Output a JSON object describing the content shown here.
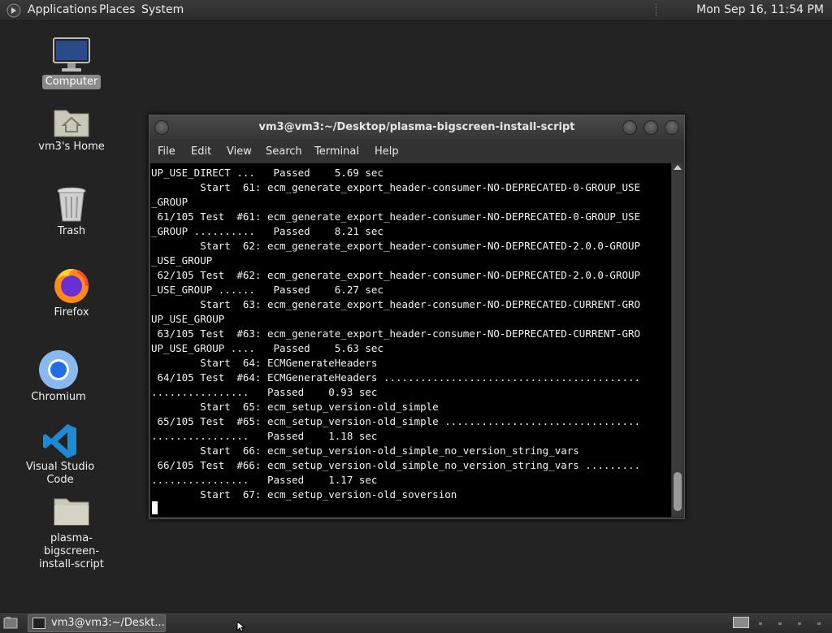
{
  "top_panel": {
    "menus": [
      "Applications",
      "Places",
      "System"
    ],
    "clock": "Mon Sep 16, 11:54 PM",
    "logo_icon": "gnome-foot-icon"
  },
  "desktop_icons": [
    {
      "label": "Computer",
      "icon": "computer-icon",
      "selected": true
    },
    {
      "label": "vm3's Home",
      "icon": "home-folder-icon"
    },
    {
      "label": "Trash",
      "icon": "trash-icon"
    },
    {
      "label": "Firefox",
      "icon": "firefox-icon"
    },
    {
      "label": "Chromium",
      "icon": "chromium-icon"
    },
    {
      "label": "Visual Studio Code",
      "icon": "vscode-icon"
    },
    {
      "label": "plasma-bigscreen-install-script",
      "label_lines": [
        "plasma-bigscreen-",
        "install-script"
      ],
      "icon": "folder-icon"
    }
  ],
  "terminal": {
    "title": "vm3@vm3:~/Desktop/plasma-bigscreen-install-script",
    "menu": [
      "File",
      "Edit",
      "View",
      "Search",
      "Terminal",
      "Help"
    ],
    "lines": [
      "UP_USE_DIRECT ...   Passed    5.69 sec",
      "        Start  61: ecm_generate_export_header-consumer-NO-DEPRECATED-0-GROUP_USE",
      "_GROUP",
      " 61/105 Test  #61: ecm_generate_export_header-consumer-NO-DEPRECATED-0-GROUP_USE",
      "_GROUP ..........   Passed    8.21 sec",
      "        Start  62: ecm_generate_export_header-consumer-NO-DEPRECATED-2.0.0-GROUP",
      "_USE_GROUP",
      " 62/105 Test  #62: ecm_generate_export_header-consumer-NO-DEPRECATED-2.0.0-GROUP",
      "_USE_GROUP ......   Passed    6.27 sec",
      "        Start  63: ecm_generate_export_header-consumer-NO-DEPRECATED-CURRENT-GRO",
      "UP_USE_GROUP",
      " 63/105 Test  #63: ecm_generate_export_header-consumer-NO-DEPRECATED-CURRENT-GRO",
      "UP_USE_GROUP ....   Passed    5.63 sec",
      "        Start  64: ECMGenerateHeaders",
      " 64/105 Test  #64: ECMGenerateHeaders ..........................................",
      "................   Passed    0.93 sec",
      "        Start  65: ecm_setup_version-old_simple",
      " 65/105 Test  #65: ecm_setup_version-old_simple ................................",
      "................   Passed    1.18 sec",
      "        Start  66: ecm_setup_version-old_simple_no_version_string_vars",
      " 66/105 Test  #66: ecm_setup_version-old_simple_no_version_string_vars .........",
      "................   Passed    1.17 sec",
      "        Start  67: ecm_setup_version-old_soversion"
    ]
  },
  "bottom_panel": {
    "taskbar_item": "vm3@vm3:~/Deskt..."
  }
}
